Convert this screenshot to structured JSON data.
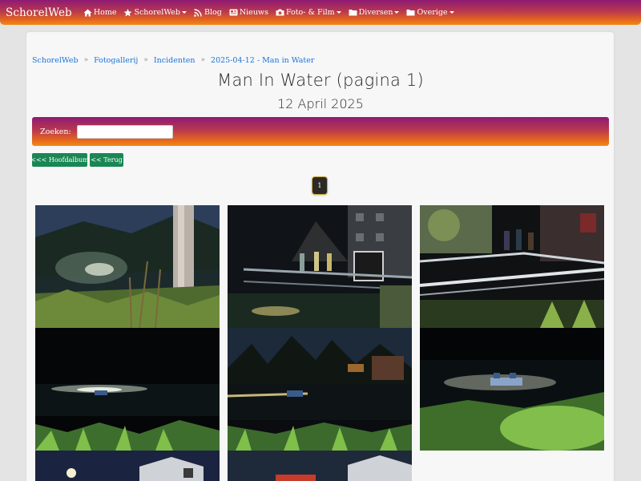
{
  "navbar": {
    "brand": "SchorelWeb",
    "items": [
      {
        "label": "Home",
        "icon": "home-icon",
        "dropdown": false
      },
      {
        "label": "SchorelWeb",
        "icon": "star-icon",
        "dropdown": true
      },
      {
        "label": "Blog",
        "icon": "rss-icon",
        "dropdown": false
      },
      {
        "label": "Nieuws",
        "icon": "newspaper-icon",
        "dropdown": false
      },
      {
        "label": "Foto- & Film",
        "icon": "camera-icon",
        "dropdown": true
      },
      {
        "label": "Diversen",
        "icon": "folder-icon",
        "dropdown": true
      },
      {
        "label": "Overige",
        "icon": "folder-icon",
        "dropdown": true
      }
    ],
    "gradient_colors": [
      "#8e1a73",
      "#e5661e",
      "#f28a12"
    ]
  },
  "breadcrumb": [
    "SchorelWeb",
    "Fotogallerij",
    "Incidenten",
    "2025-04-12 - Man in Water"
  ],
  "page": {
    "title": "Man In Water (pagina 1)",
    "date": "12 April 2025"
  },
  "search": {
    "label": "Zoeken:",
    "value": "",
    "placeholder": ""
  },
  "buttons": {
    "main_album": "<<< Hoofdalbum",
    "back": "<< Terug"
  },
  "pagination": {
    "current": "1"
  },
  "gallery": {
    "photos": [
      {
        "alt": "photo-1"
      },
      {
        "alt": "photo-2"
      },
      {
        "alt": "photo-3"
      },
      {
        "alt": "photo-4"
      },
      {
        "alt": "photo-5"
      },
      {
        "alt": "photo-6"
      },
      {
        "alt": "photo-7"
      },
      {
        "alt": "photo-8"
      }
    ]
  }
}
